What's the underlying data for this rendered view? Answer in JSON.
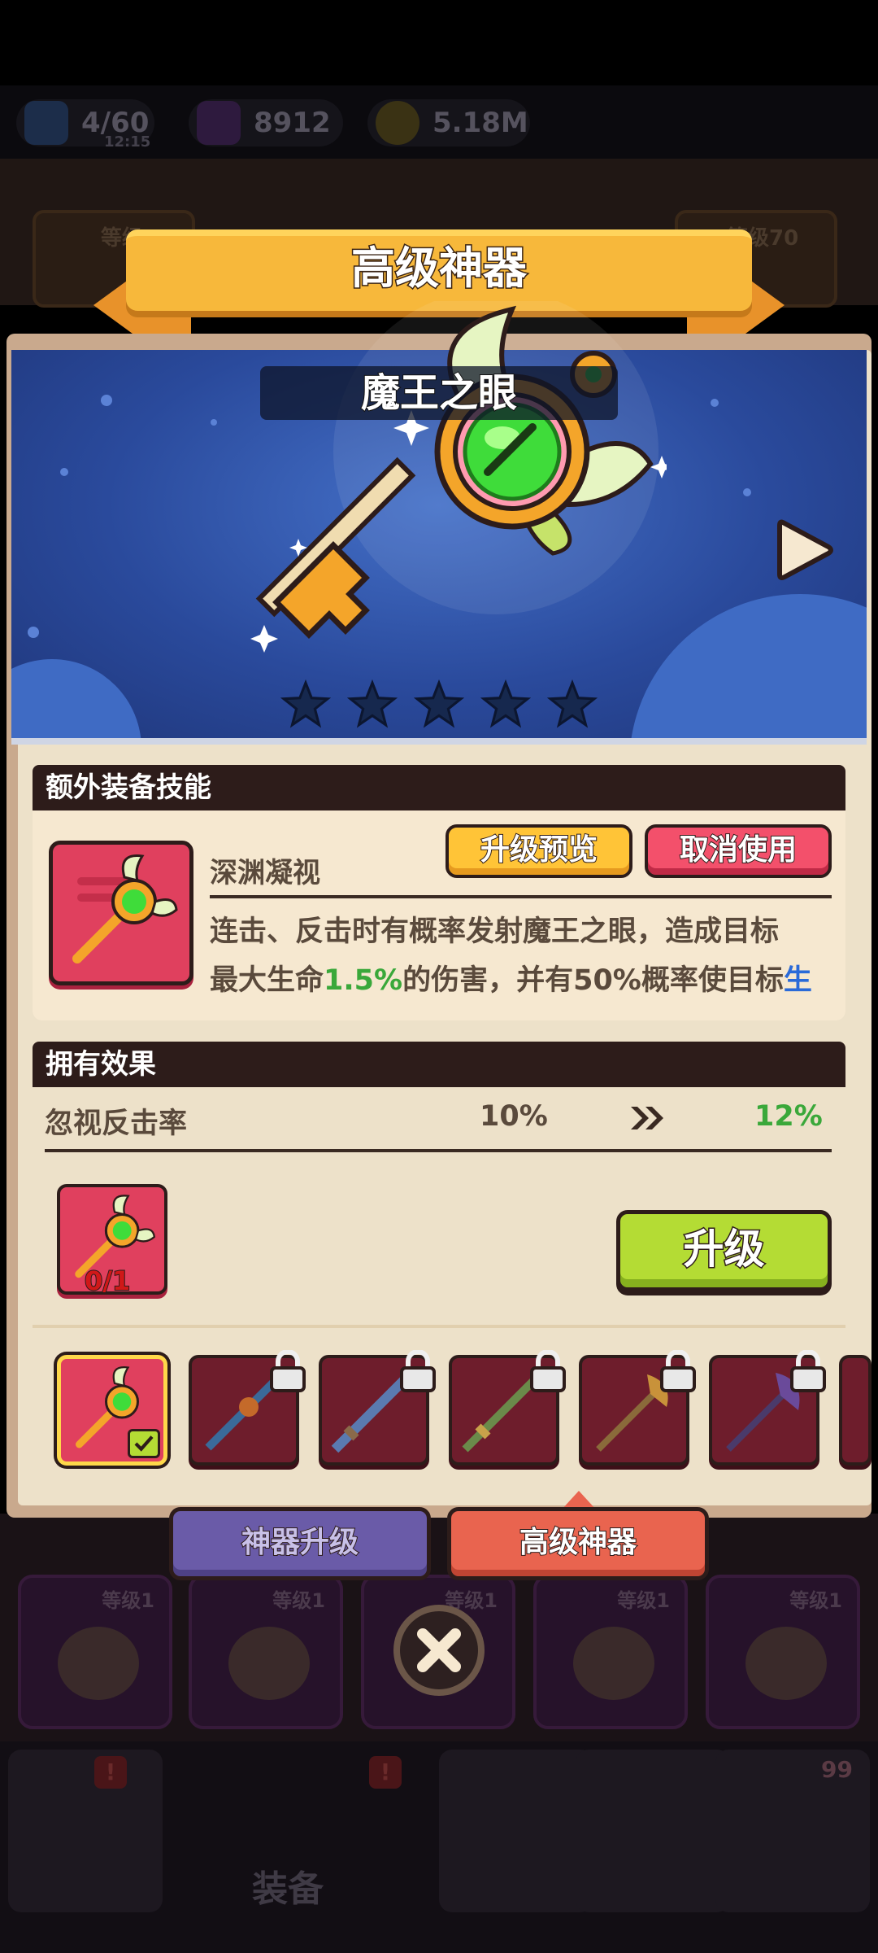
{
  "resources": {
    "energy": "4/60",
    "energy_timer": "12:15",
    "gems": "8912",
    "gold": "5.18M"
  },
  "background": {
    "level_badges": [
      "等级",
      "等级70"
    ],
    "cards": [
      "等级1",
      "等级1",
      "等级1",
      "等级1",
      "等级1"
    ],
    "nav_label": "装备",
    "nav_count": "99"
  },
  "dialog": {
    "title": "高级神器",
    "artifact_name": "魔王之眼",
    "stars": 5,
    "skill_section": {
      "header": "额外装备技能",
      "skill_name": "深渊凝视",
      "preview_button": "升级预览",
      "cancel_button": "取消使用",
      "desc_line1": "连击、反击时有概率发射魔王之眼，造成目标",
      "desc_line2_a": "最大生命",
      "desc_line2_hl": "1.5%",
      "desc_line2_b": "的伤害，并有50%概率使目标",
      "desc_line2_tail": "生"
    },
    "effect_section": {
      "header": "拥有效果",
      "effect_label": "忽视反击率",
      "current_value": "10%",
      "next_value": "12%"
    },
    "shard_count": "0/1",
    "upgrade_button": "升级",
    "tabs": {
      "artifact_upgrade": "神器升级",
      "advanced_artifact": "高级神器"
    }
  },
  "colors": {
    "accent_red": "#e0405e",
    "accent_green": "#b4dc34",
    "accent_yellow": "#ffc437",
    "panel_bg": "#ede1c9",
    "dark_outline": "#2d1c1a"
  }
}
